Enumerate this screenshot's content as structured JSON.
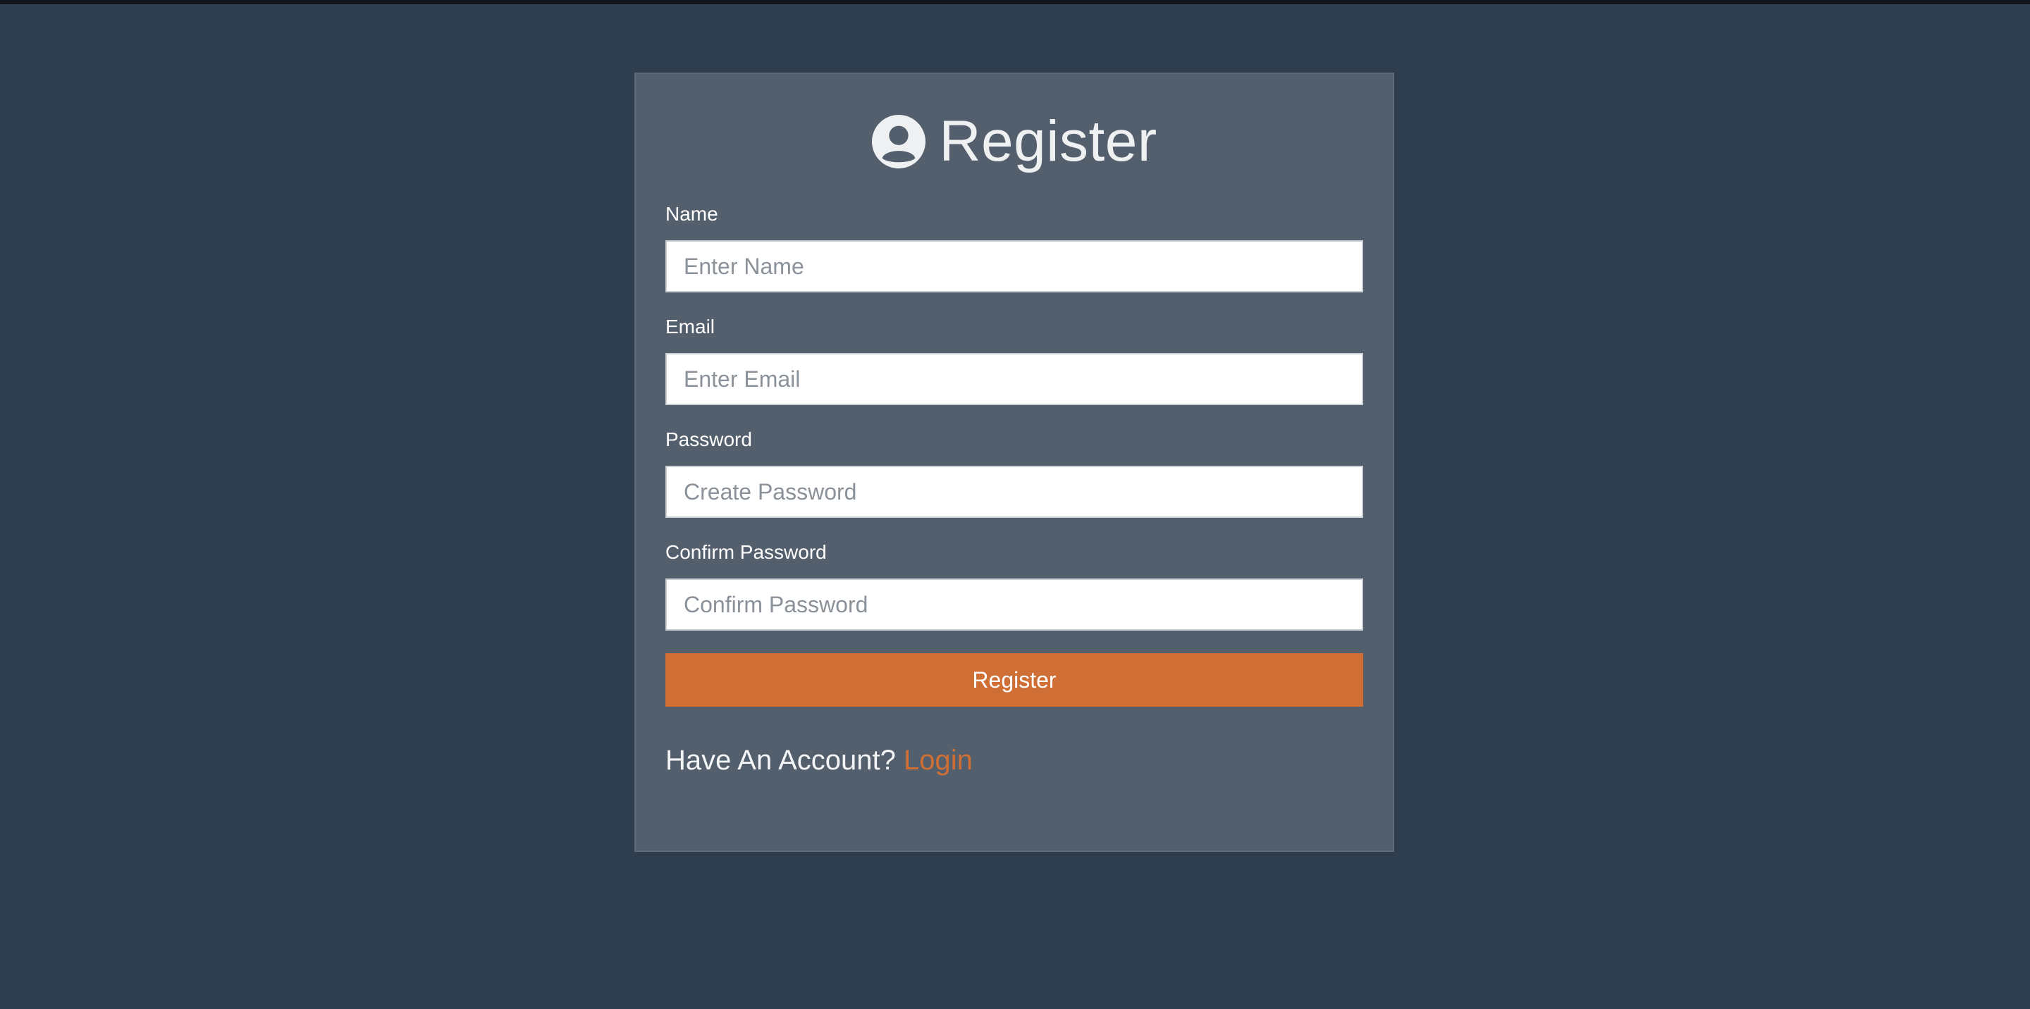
{
  "page": {
    "background_color": "#2f3e4f",
    "accent_color": "#d06f35",
    "card_color": "#535f6c"
  },
  "header": {
    "icon": "user-circle-icon",
    "title": "Register"
  },
  "form": {
    "fields": [
      {
        "label": "Name",
        "placeholder": "Enter Name",
        "value": ""
      },
      {
        "label": "Email",
        "placeholder": "Enter Email",
        "value": ""
      },
      {
        "label": "Password",
        "placeholder": "Create Password",
        "value": ""
      },
      {
        "label": "Confirm Password",
        "placeholder": "Confirm Password",
        "value": ""
      }
    ],
    "submit_label": "Register"
  },
  "footer": {
    "prompt": "Have An Account?",
    "link_label": "Login"
  }
}
